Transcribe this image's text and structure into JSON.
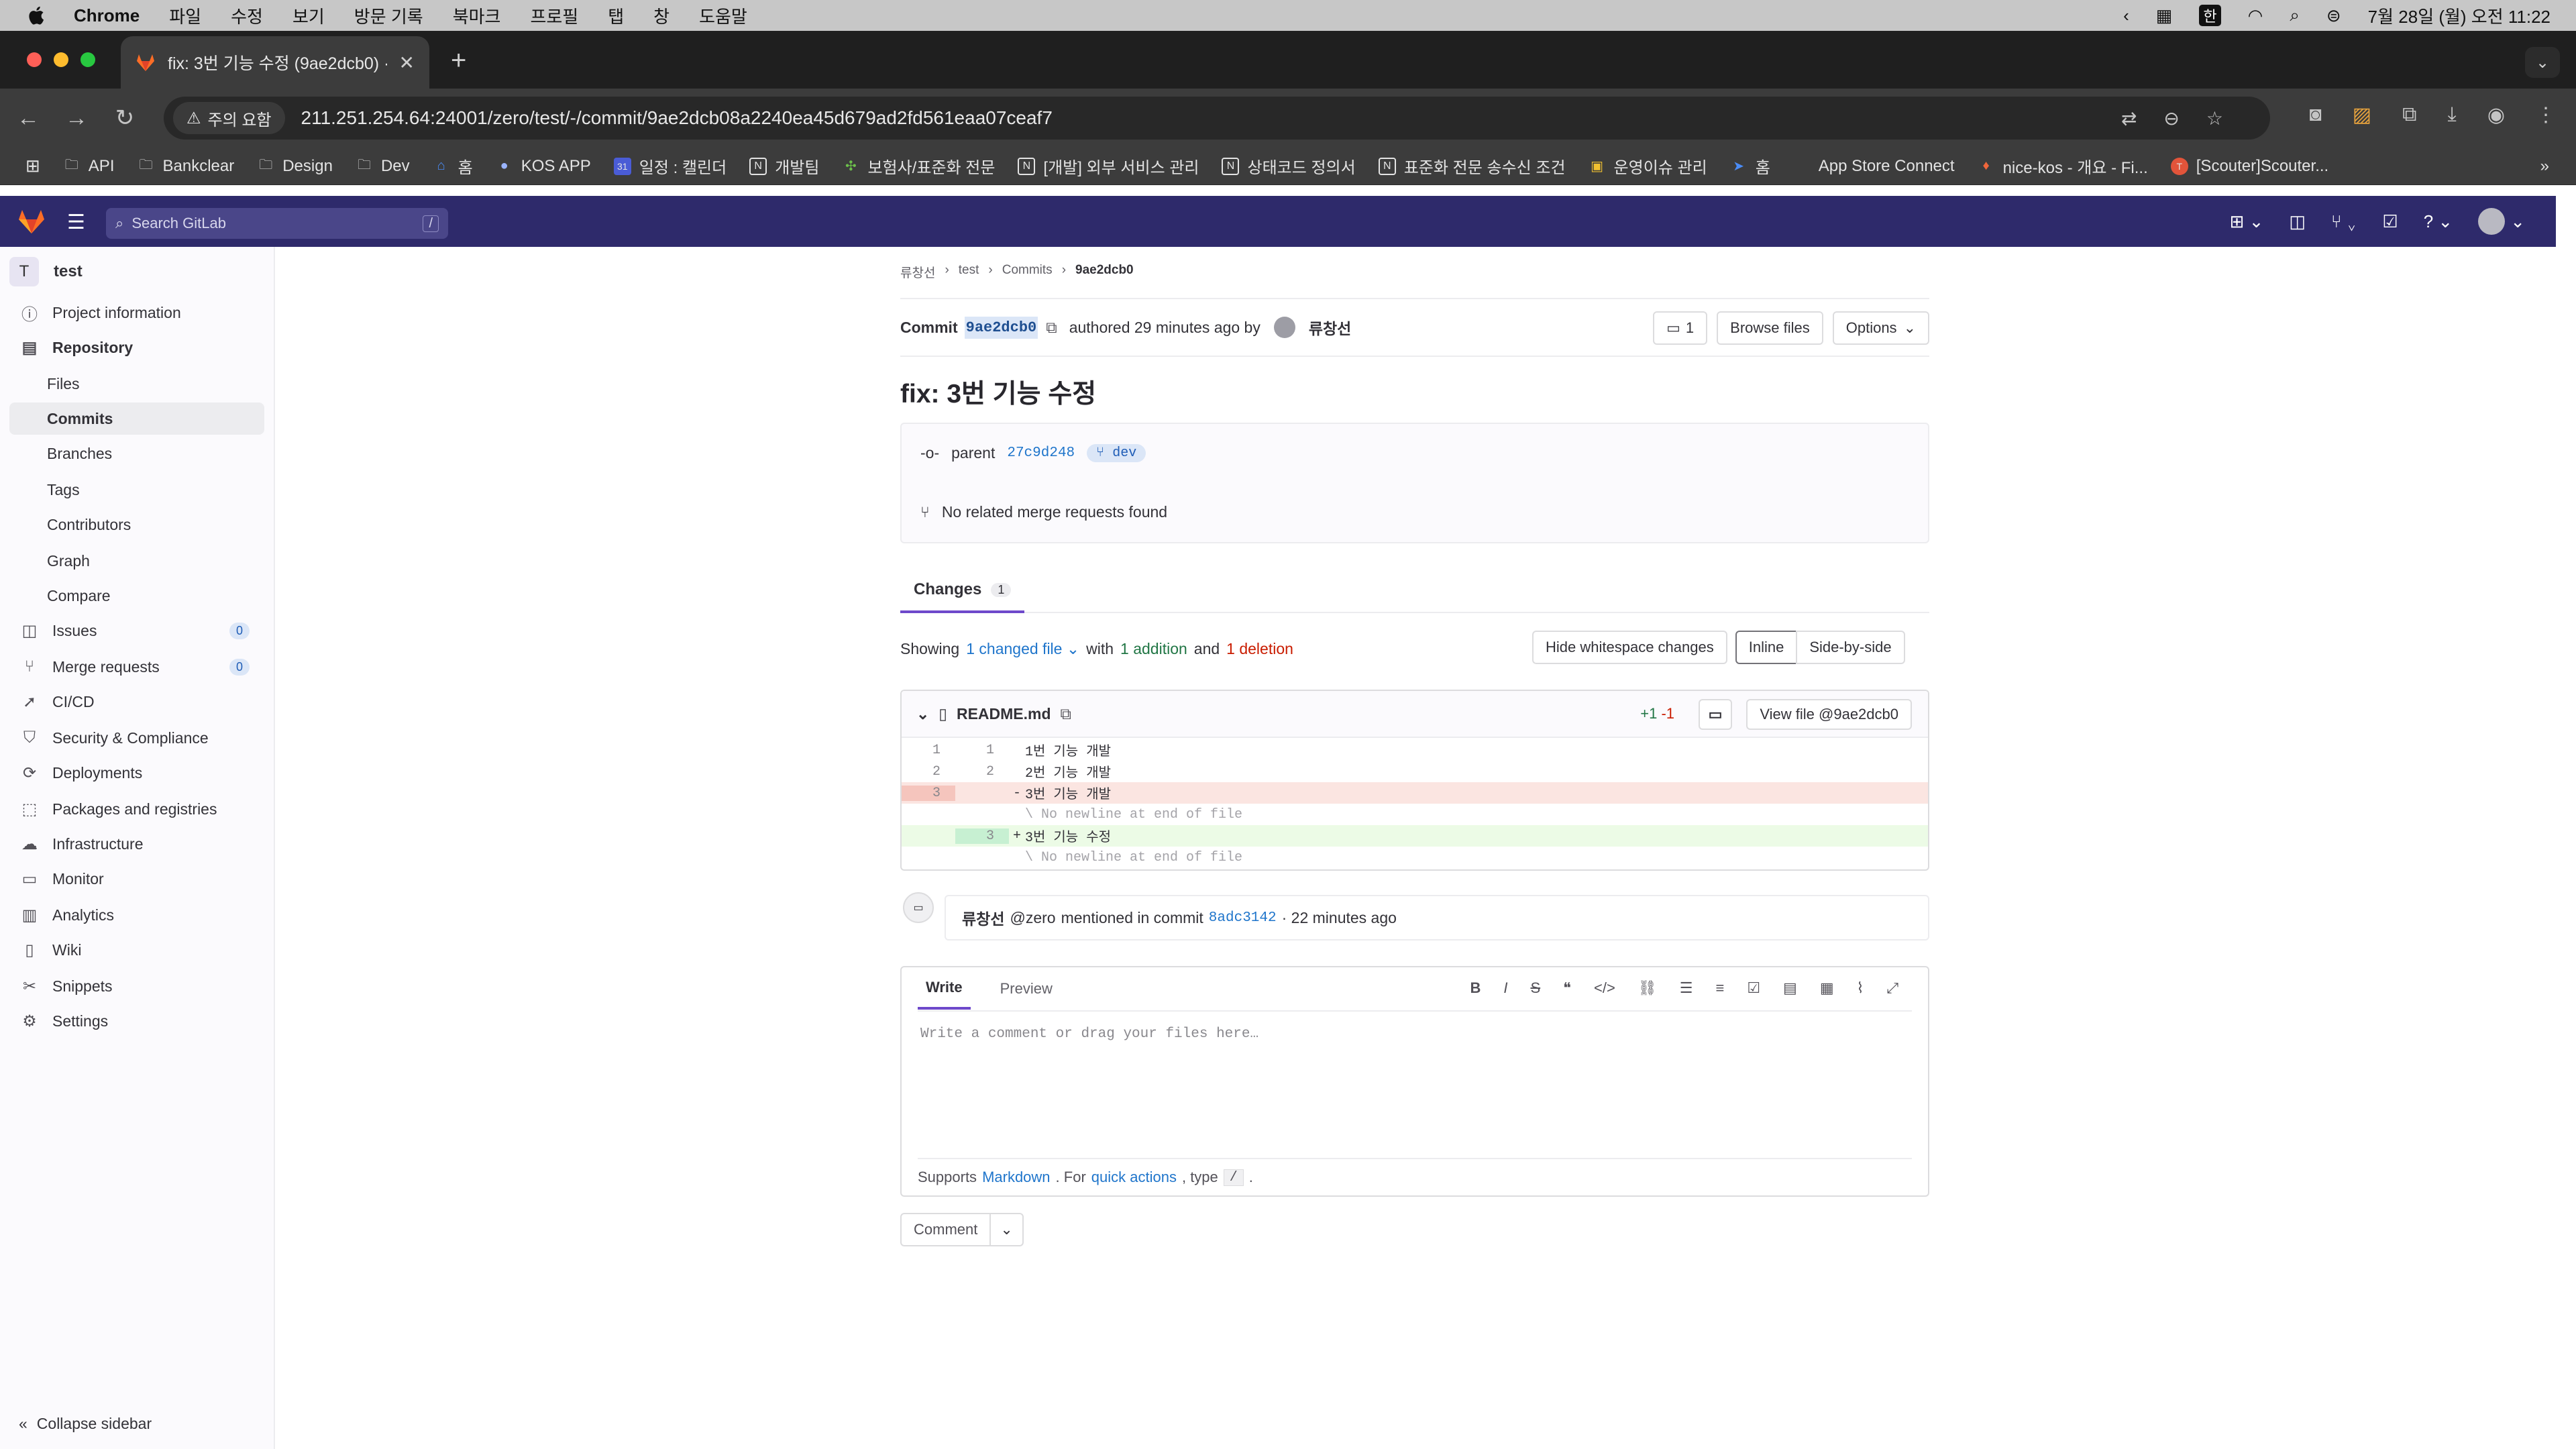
{
  "menubar": {
    "app": "Chrome",
    "menus": [
      "파일",
      "수정",
      "보기",
      "방문 기록",
      "북마크",
      "프로필",
      "탭",
      "창",
      "도움말"
    ],
    "ime": "한",
    "datetime": "7월 28일 (월) 오전 11:22"
  },
  "browser": {
    "tab_title": "fix: 3번 기능 수정 (9ae2dcb0) ·",
    "security_label": "주의 요함",
    "url": "211.251.254.64:24001/zero/test/-/commit/9ae2dcb08a2240ea45d679ad2fd561eaa07ceaf7"
  },
  "bookmarks": [
    "API",
    "Bankclear",
    "Design",
    "Dev",
    "홈",
    "KOS APP",
    "일정 : 캘린더",
    "개발팀",
    "보험사/표준화 전문",
    "[개발] 외부 서비스 관리",
    "상태코드 정의서",
    "표준화 전문 송수신 조건",
    "운영이슈 관리",
    "홈",
    "App Store Connect",
    "nice-kos - 개요 - Fi...",
    "[Scouter]Scouter..."
  ],
  "gitlab": {
    "search_placeholder": "Search GitLab",
    "search_shortcut": "/"
  },
  "sidebar": {
    "project_initial": "T",
    "project_name": "test",
    "items": [
      {
        "label": "Project information",
        "icon": "info-icon"
      },
      {
        "label": "Repository",
        "icon": "repo-icon"
      },
      {
        "label": "Files"
      },
      {
        "label": "Commits"
      },
      {
        "label": "Branches"
      },
      {
        "label": "Tags"
      },
      {
        "label": "Contributors"
      },
      {
        "label": "Graph"
      },
      {
        "label": "Compare"
      },
      {
        "label": "Issues",
        "icon": "issues-icon",
        "badge": "0"
      },
      {
        "label": "Merge requests",
        "icon": "merge-request-icon",
        "badge": "0"
      },
      {
        "label": "CI/CD",
        "icon": "rocket-icon"
      },
      {
        "label": "Security & Compliance",
        "icon": "shield-icon"
      },
      {
        "label": "Deployments",
        "icon": "deployments-icon"
      },
      {
        "label": "Packages and registries",
        "icon": "package-icon"
      },
      {
        "label": "Infrastructure",
        "icon": "cloud-icon"
      },
      {
        "label": "Monitor",
        "icon": "monitor-icon"
      },
      {
        "label": "Analytics",
        "icon": "chart-icon"
      },
      {
        "label": "Wiki",
        "icon": "book-icon"
      },
      {
        "label": "Snippets",
        "icon": "scissors-icon"
      },
      {
        "label": "Settings",
        "icon": "gear-icon"
      }
    ],
    "collapse_label": "Collapse sidebar"
  },
  "breadcrumb": [
    "류창선",
    "test",
    "Commits",
    "9ae2dcb0"
  ],
  "commit": {
    "label": "Commit",
    "sha": "9ae2dcb0",
    "authored": "authored 29 minutes ago by",
    "author": "류창선",
    "comments_count": "1",
    "browse_files": "Browse files",
    "options": "Options",
    "title": "fix: 3번 기능 수정",
    "parent_label": "parent",
    "parent_sha": "27c9d248",
    "branch": "dev",
    "no_mr": "No related merge requests found"
  },
  "tabs": {
    "changes_label": "Changes",
    "changes_count": "1"
  },
  "summary": {
    "showing": "Showing",
    "changed_files": "1 changed file",
    "with": "with",
    "additions": "1 addition",
    "and": "and",
    "deletions": "1 deletion",
    "hide_whitespace": "Hide whitespace changes",
    "inline": "Inline",
    "side_by_side": "Side-by-side"
  },
  "file": {
    "name": "README.md",
    "added": "+1",
    "removed": "-1",
    "view_file": "View file @9ae2dcb0",
    "lines": [
      {
        "type": "context",
        "old": "1",
        "new": "1",
        "sign": "",
        "text": "1번 기능 개발"
      },
      {
        "type": "context",
        "old": "2",
        "new": "2",
        "sign": "",
        "text": "2번 기능 개발"
      },
      {
        "type": "old",
        "old": "3",
        "new": "",
        "sign": "-",
        "text": "3번 기능 개발"
      },
      {
        "type": "meta",
        "old": "",
        "new": "",
        "sign": "",
        "text": "\\ No newline at end of file"
      },
      {
        "type": "new",
        "old": "",
        "new": "3",
        "sign": "+",
        "text": "3번 기능 수정"
      },
      {
        "type": "meta",
        "old": "",
        "new": "",
        "sign": "",
        "text": "\\ No newline at end of file"
      }
    ]
  },
  "note": {
    "author": "류창선",
    "handle": "@zero",
    "mention_text": "mentioned in commit",
    "commit": "8adc3142",
    "time": "· 22 minutes ago"
  },
  "editor": {
    "write_tab": "Write",
    "preview_tab": "Preview",
    "placeholder": "Write a comment or drag your files here…",
    "footer_supports": "Supports",
    "footer_markdown": "Markdown",
    "footer_for": ". For",
    "footer_quick_actions": "quick actions",
    "footer_type": ", type",
    "footer_slash": "/",
    "footer_end": ".",
    "comment_button": "Comment"
  },
  "colors": {
    "gitlab_header": "#2e2a6b",
    "accent": "#6e49cb",
    "link": "#1f75cb"
  }
}
